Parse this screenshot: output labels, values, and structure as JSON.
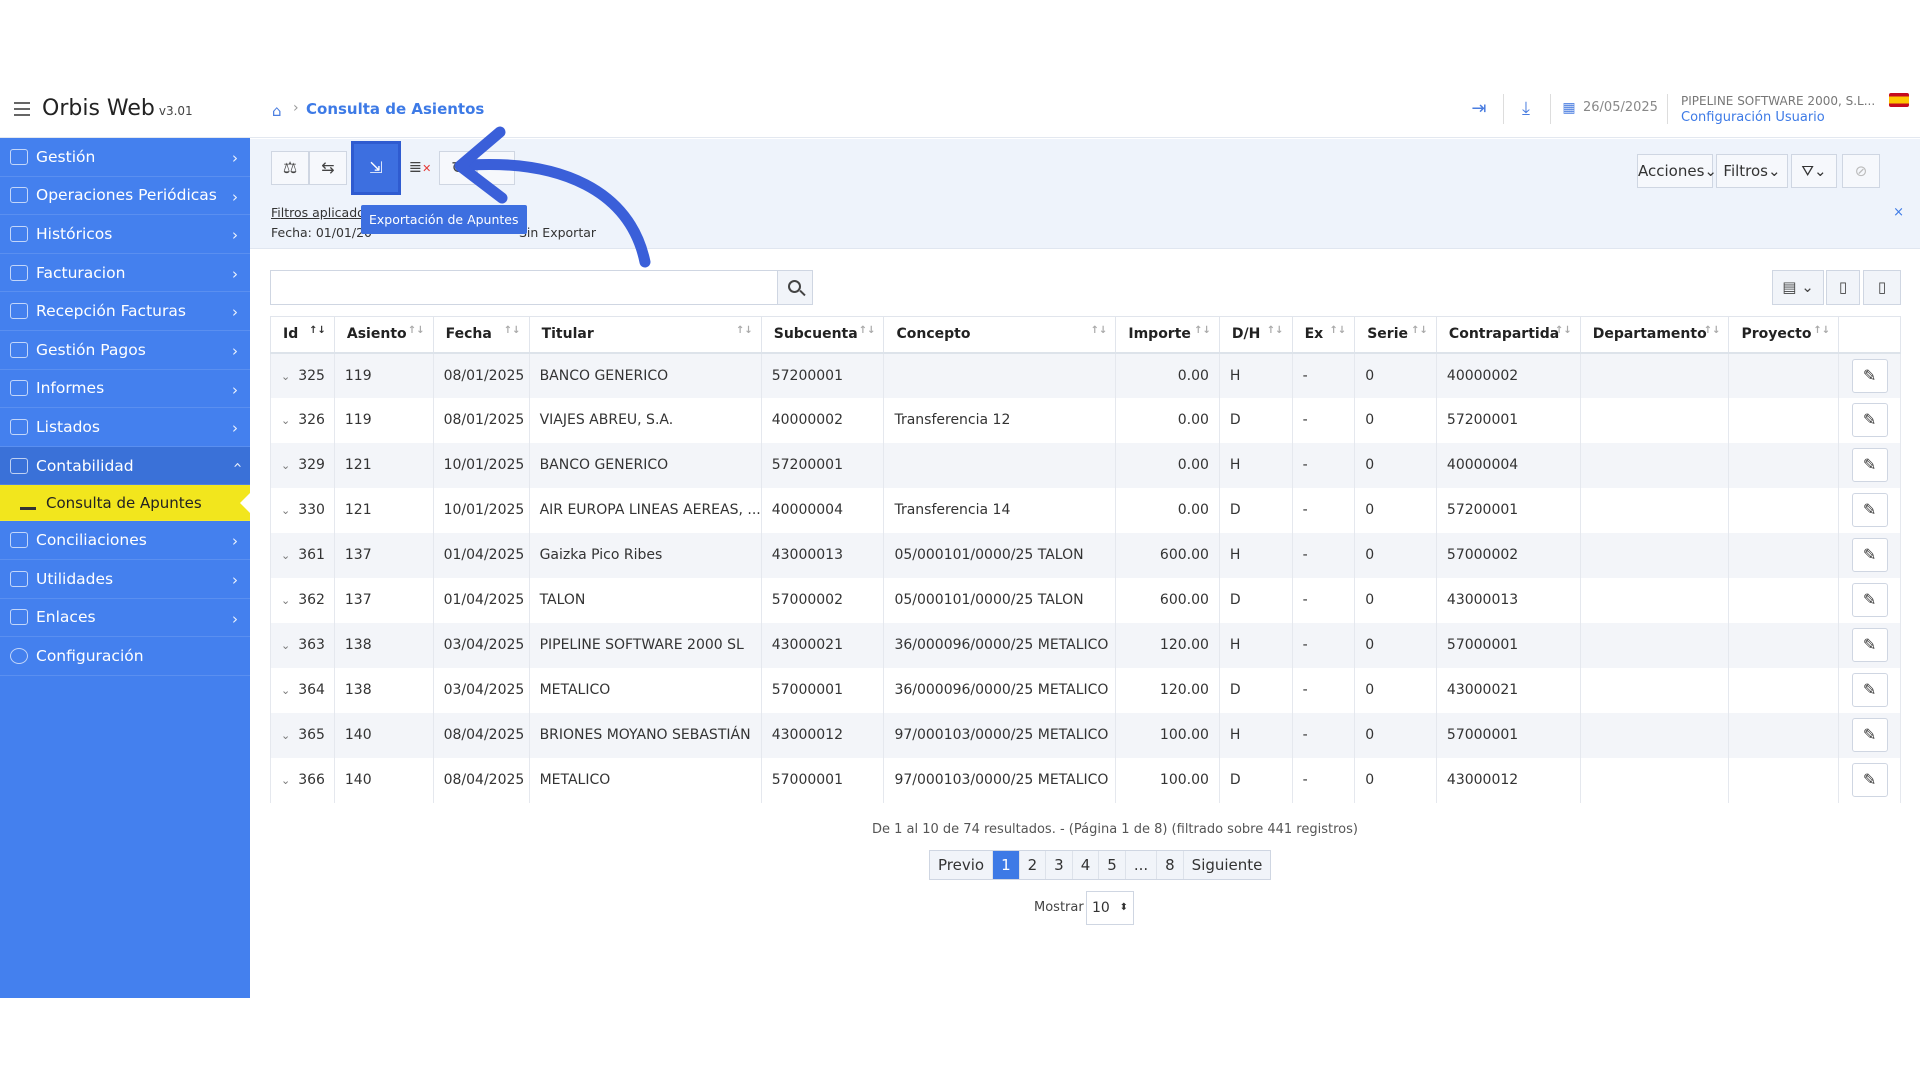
{
  "app": {
    "title": "Orbis Web",
    "version": "v3.01"
  },
  "breadcrumb": {
    "current": "Consulta de Asientos"
  },
  "header": {
    "date": "26/05/2025",
    "company": "PIPELINE SOFTWARE 2000, S.L...",
    "config_link": "Configuración Usuario"
  },
  "sidebar": {
    "items": [
      {
        "label": "Gestión"
      },
      {
        "label": "Operaciones Periódicas"
      },
      {
        "label": "Históricos"
      },
      {
        "label": "Facturacion"
      },
      {
        "label": "Recepción Facturas"
      },
      {
        "label": "Gestión Pagos"
      },
      {
        "label": "Informes"
      },
      {
        "label": "Listados"
      },
      {
        "label": "Contabilidad"
      }
    ],
    "active_sub": "Consulta de Apuntes",
    "items_after": [
      {
        "label": "Conciliaciones"
      },
      {
        "label": "Utilidades"
      },
      {
        "label": "Enlaces"
      },
      {
        "label": "Configuración"
      }
    ]
  },
  "toolbar": {
    "tooltip": "Exportación de Apuntes",
    "filters_link": "Filtros aplicado",
    "filters_date_label": "Fecha: 01/01/20",
    "filters_tail": "Sin Exportar",
    "actions_label": "Acciones",
    "filters_label": "Filtros",
    "close": "×"
  },
  "search": {
    "placeholder": ""
  },
  "table": {
    "columns": [
      "Id",
      "Asiento",
      "Fecha",
      "Titular",
      "Subcuenta",
      "Concepto",
      "Importe",
      "D/H",
      "Ex",
      "Serie",
      "Contrapartida",
      "Departamento",
      "Proyecto"
    ],
    "rows": [
      {
        "id": "325",
        "asiento": "119",
        "fecha": "08/01/2025",
        "titular": "BANCO GENERICO",
        "subcuenta": "57200001",
        "concepto": "",
        "importe": "0.00",
        "dh": "H",
        "ex": "-",
        "serie": "0",
        "contrapartida": "40000002"
      },
      {
        "id": "326",
        "asiento": "119",
        "fecha": "08/01/2025",
        "titular": "VIAJES ABREU, S.A.",
        "subcuenta": "40000002",
        "concepto": "Transferencia 12",
        "importe": "0.00",
        "dh": "D",
        "ex": "-",
        "serie": "0",
        "contrapartida": "57200001"
      },
      {
        "id": "329",
        "asiento": "121",
        "fecha": "10/01/2025",
        "titular": "BANCO GENERICO",
        "subcuenta": "57200001",
        "concepto": "",
        "importe": "0.00",
        "dh": "H",
        "ex": "-",
        "serie": "0",
        "contrapartida": "40000004"
      },
      {
        "id": "330",
        "asiento": "121",
        "fecha": "10/01/2025",
        "titular": "AIR EUROPA LINEAS AEREAS, ...",
        "subcuenta": "40000004",
        "concepto": "Transferencia 14",
        "importe": "0.00",
        "dh": "D",
        "ex": "-",
        "serie": "0",
        "contrapartida": "57200001"
      },
      {
        "id": "361",
        "asiento": "137",
        "fecha": "01/04/2025",
        "titular": "Gaizka Pico Ribes",
        "subcuenta": "43000013",
        "concepto": "05/000101/0000/25 TALON",
        "importe": "600.00",
        "dh": "H",
        "ex": "-",
        "serie": "0",
        "contrapartida": "57000002"
      },
      {
        "id": "362",
        "asiento": "137",
        "fecha": "01/04/2025",
        "titular": "TALON",
        "subcuenta": "57000002",
        "concepto": "05/000101/0000/25 TALON",
        "importe": "600.00",
        "dh": "D",
        "ex": "-",
        "serie": "0",
        "contrapartida": "43000013"
      },
      {
        "id": "363",
        "asiento": "138",
        "fecha": "03/04/2025",
        "titular": "PIPELINE SOFTWARE 2000 SL",
        "subcuenta": "43000021",
        "concepto": "36/000096/0000/25 METALICO",
        "importe": "120.00",
        "dh": "H",
        "ex": "-",
        "serie": "0",
        "contrapartida": "57000001"
      },
      {
        "id": "364",
        "asiento": "138",
        "fecha": "03/04/2025",
        "titular": "METALICO",
        "subcuenta": "57000001",
        "concepto": "36/000096/0000/25 METALICO",
        "importe": "120.00",
        "dh": "D",
        "ex": "-",
        "serie": "0",
        "contrapartida": "43000021"
      },
      {
        "id": "365",
        "asiento": "140",
        "fecha": "08/04/2025",
        "titular": "BRIONES MOYANO SEBASTIÁN",
        "subcuenta": "43000012",
        "concepto": "97/000103/0000/25 METALICO",
        "importe": "100.00",
        "dh": "H",
        "ex": "-",
        "serie": "0",
        "contrapartida": "57000001"
      },
      {
        "id": "366",
        "asiento": "140",
        "fecha": "08/04/2025",
        "titular": "METALICO",
        "subcuenta": "57000001",
        "concepto": "97/000103/0000/25 METALICO",
        "importe": "100.00",
        "dh": "D",
        "ex": "-",
        "serie": "0",
        "contrapartida": "43000012"
      }
    ]
  },
  "pagination": {
    "info": "De 1 al 10 de 74 resultados. - (Página 1 de 8) (filtrado sobre 441 registros)",
    "prev": "Previo",
    "pages": [
      "1",
      "2",
      "3",
      "4",
      "5",
      "...",
      "8"
    ],
    "current": "1",
    "next": "Siguiente",
    "show_label": "Mostrar",
    "show_value": "10"
  },
  "colors": {
    "sidebar": "#4480ee",
    "accent": "#3d7ae6",
    "active_sub": "#f2e61d",
    "arrow": "#3a5fd9"
  }
}
